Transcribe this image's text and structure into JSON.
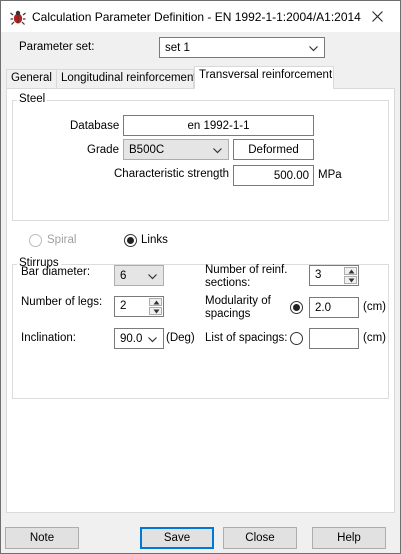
{
  "window": {
    "title": "Calculation Parameter Definition - EN 1992-1-1:2004/A1:2014"
  },
  "parameter_set": {
    "label": "Parameter set:",
    "value": "set 1"
  },
  "tabs": [
    {
      "label": "General"
    },
    {
      "label": "Longitudinal reinforcement"
    },
    {
      "label": "Transversal reinforcement",
      "active": true
    }
  ],
  "steel": {
    "title": "Steel",
    "database_label": "Database",
    "database_value": "en 1992-1-1",
    "grade_label": "Grade",
    "grade_value": "B500C",
    "type_value": "Deformed",
    "strength_label": "Characteristic strength",
    "strength_value": "500.00",
    "strength_unit": "MPa"
  },
  "reinforcement_type": {
    "spiral_label": "Spiral",
    "links_label": "Links",
    "selected": "Links"
  },
  "stirrups": {
    "title": "Stirrups",
    "bar_diameter_label": "Bar diameter:",
    "bar_diameter_value": "6",
    "num_sections_label_1": "Number of reinf.",
    "num_sections_label_2": "sections:",
    "num_sections_value": "3",
    "num_legs_label": "Number of legs:",
    "num_legs_value": "2",
    "modularity_label_1": "Modularity of",
    "modularity_label_2": "spacings",
    "modularity_value": "2.0",
    "modularity_unit": "(cm)",
    "inclination_label": "Inclination:",
    "inclination_value": "90.0",
    "inclination_unit": "(Deg)",
    "list_spacings_label": "List of spacings:",
    "list_spacings_value": "",
    "list_spacings_unit": "(cm)",
    "spacing_mode": "modularity"
  },
  "buttons": {
    "note": "Note",
    "save": "Save",
    "close": "Close",
    "help": "Help"
  },
  "colors": {
    "window_bg": "#f0f0f0",
    "focus_border": "#0078d7",
    "disabled_text": "#a0a0a0"
  }
}
